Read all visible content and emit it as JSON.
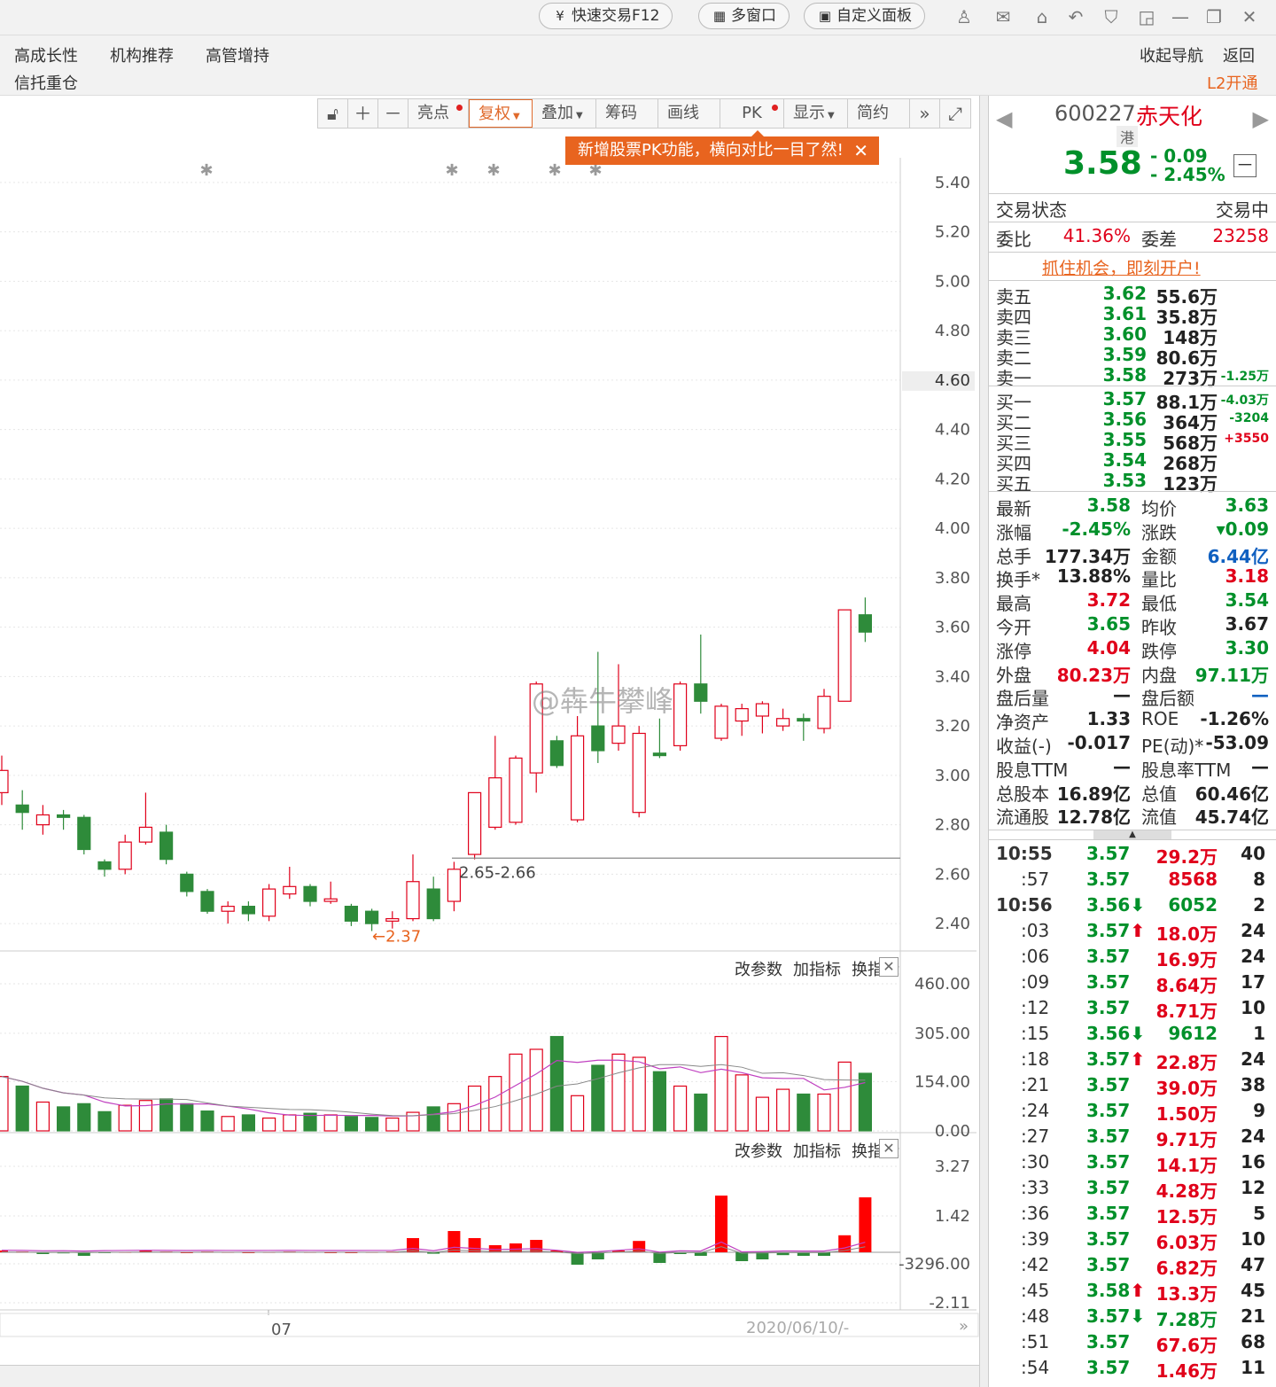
{
  "titlebar": {
    "quick_trade": "快速交易F12",
    "multi_window": "多窗口",
    "custom_panel": "自定义面板"
  },
  "nav": {
    "items": [
      "高成长性",
      "机构推荐",
      "高管增持",
      "信托重仓"
    ],
    "collapse": "收起导航",
    "back": "返回",
    "l2": "L2开通"
  },
  "toolbar": {
    "highlight": "亮点",
    "restore_rights": "复权",
    "overlay": "叠加",
    "chips": "筹码",
    "draw": "画线",
    "pk": "PK",
    "display": "显示",
    "simple": "简约"
  },
  "tooltip": "新增股票PK功能，横向对比一目了然!",
  "pane": {
    "change_params": "改参数",
    "add_indicator": "加指标",
    "switch_indicator": "换指标"
  },
  "watermark": "@犇牛攀峰",
  "chart_data": {
    "type": "candlestick",
    "price_axis": [
      "5.40",
      "5.20",
      "5.00",
      "4.80",
      "4.60",
      "4.40",
      "4.20",
      "4.00",
      "3.80",
      "3.60",
      "3.40",
      "3.20",
      "3.00",
      "2.80",
      "2.60",
      "2.40"
    ],
    "price_range": [
      2.3,
      5.5
    ],
    "current_price_label": "4.60",
    "candles": [
      {
        "o": 2.93,
        "c": 3.02,
        "h": 3.08,
        "l": 2.88
      },
      {
        "o": 2.88,
        "c": 2.85,
        "h": 2.94,
        "l": 2.78
      },
      {
        "o": 2.8,
        "c": 2.84,
        "h": 2.88,
        "l": 2.76
      },
      {
        "o": 2.84,
        "c": 2.83,
        "h": 2.86,
        "l": 2.78
      },
      {
        "o": 2.83,
        "c": 2.7,
        "h": 2.84,
        "l": 2.68
      },
      {
        "o": 2.65,
        "c": 2.62,
        "h": 2.66,
        "l": 2.59
      },
      {
        "o": 2.62,
        "c": 2.73,
        "h": 2.76,
        "l": 2.6
      },
      {
        "o": 2.73,
        "c": 2.79,
        "h": 2.93,
        "l": 2.72
      },
      {
        "o": 2.77,
        "c": 2.66,
        "h": 2.8,
        "l": 2.64
      },
      {
        "o": 2.6,
        "c": 2.53,
        "h": 2.61,
        "l": 2.51
      },
      {
        "o": 2.53,
        "c": 2.45,
        "h": 2.54,
        "l": 2.44
      },
      {
        "o": 2.45,
        "c": 2.47,
        "h": 2.49,
        "l": 2.4
      },
      {
        "o": 2.47,
        "c": 2.44,
        "h": 2.49,
        "l": 2.41
      },
      {
        "o": 2.43,
        "c": 2.54,
        "h": 2.56,
        "l": 2.41
      },
      {
        "o": 2.52,
        "c": 2.55,
        "h": 2.63,
        "l": 2.5
      },
      {
        "o": 2.55,
        "c": 2.49,
        "h": 2.56,
        "l": 2.47
      },
      {
        "o": 2.49,
        "c": 2.5,
        "h": 2.57,
        "l": 2.48
      },
      {
        "o": 2.47,
        "c": 2.41,
        "h": 2.48,
        "l": 2.39
      },
      {
        "o": 2.45,
        "c": 2.4,
        "h": 2.46,
        "l": 2.37
      },
      {
        "o": 2.41,
        "c": 2.42,
        "h": 2.45,
        "l": 2.38
      },
      {
        "o": 2.42,
        "c": 2.57,
        "h": 2.68,
        "l": 2.41
      },
      {
        "o": 2.54,
        "c": 2.42,
        "h": 2.59,
        "l": 2.41
      },
      {
        "o": 2.49,
        "c": 2.62,
        "h": 2.65,
        "l": 2.45
      },
      {
        "o": 2.68,
        "c": 2.93,
        "h": 2.93,
        "l": 2.66
      },
      {
        "o": 2.79,
        "c": 2.99,
        "h": 3.16,
        "l": 2.78
      },
      {
        "o": 2.81,
        "c": 3.07,
        "h": 3.08,
        "l": 2.8
      },
      {
        "o": 3.01,
        "c": 3.37,
        "h": 3.38,
        "l": 2.93
      },
      {
        "o": 3.14,
        "c": 3.04,
        "h": 3.16,
        "l": 3.03
      },
      {
        "o": 2.82,
        "c": 3.16,
        "h": 3.24,
        "l": 2.81
      },
      {
        "o": 3.2,
        "c": 3.1,
        "h": 3.5,
        "l": 3.05
      },
      {
        "o": 3.13,
        "c": 3.2,
        "h": 3.45,
        "l": 3.1
      },
      {
        "o": 2.85,
        "c": 3.17,
        "h": 3.2,
        "l": 2.83
      },
      {
        "o": 3.09,
        "c": 3.08,
        "h": 3.23,
        "l": 3.07
      },
      {
        "o": 3.12,
        "c": 3.37,
        "h": 3.38,
        "l": 3.1
      },
      {
        "o": 3.37,
        "c": 3.3,
        "h": 3.57,
        "l": 3.25
      },
      {
        "o": 3.15,
        "c": 3.28,
        "h": 3.29,
        "l": 3.14
      },
      {
        "o": 3.22,
        "c": 3.27,
        "h": 3.29,
        "l": 3.16
      },
      {
        "o": 3.24,
        "c": 3.29,
        "h": 3.3,
        "l": 3.17
      },
      {
        "o": 3.2,
        "c": 3.23,
        "h": 3.27,
        "l": 3.18
      },
      {
        "o": 3.23,
        "c": 3.22,
        "h": 3.25,
        "l": 3.14
      },
      {
        "o": 3.19,
        "c": 3.32,
        "h": 3.35,
        "l": 3.17
      },
      {
        "o": 3.3,
        "c": 3.67,
        "h": 3.67,
        "l": 3.3
      },
      {
        "o": 3.65,
        "c": 3.58,
        "h": 3.72,
        "l": 3.54
      }
    ],
    "annotations": {
      "low_label": "←2.37",
      "range_label": "2.65-2.66"
    },
    "volume_axis": [
      "460.00",
      "305.00",
      "154.00",
      "0.00"
    ],
    "volume_max": 460,
    "volumes": [
      170,
      140,
      90,
      75,
      85,
      60,
      80,
      95,
      100,
      85,
      62,
      45,
      50,
      40,
      50,
      55,
      50,
      45,
      42,
      40,
      58,
      75,
      85,
      140,
      170,
      240,
      255,
      295,
      110,
      205,
      240,
      230,
      185,
      140,
      115,
      295,
      175,
      105,
      130,
      115,
      115,
      215,
      180
    ],
    "macd_axis": [
      "3.27",
      "1.42",
      "-3296.00",
      "-2.11"
    ],
    "macd": [
      0.05,
      0.02,
      -0.05,
      -0.03,
      -0.1,
      -0.02,
      0.01,
      0.05,
      0.02,
      0.0,
      0.02,
      0.01,
      0.0,
      0.01,
      0.02,
      0.01,
      0.0,
      0.0,
      0.01,
      0.02,
      0.4,
      -0.04,
      0.6,
      0.4,
      0.2,
      0.25,
      0.35,
      0.05,
      -0.35,
      -0.2,
      0.05,
      0.32,
      -0.3,
      -0.05,
      -0.1,
      1.6,
      -0.25,
      -0.2,
      -0.08,
      -0.1,
      -0.1,
      0.48,
      1.55
    ],
    "x_label": "07",
    "bottom_date": "2020/06/10/-"
  },
  "quote": {
    "code": "600227",
    "name": "赤天化",
    "hk_tag": "港",
    "price": "3.58",
    "change": "- 0.09",
    "pct": "- 2.45%",
    "status_label": "交易状态",
    "status_value": "交易中",
    "weibi_label": "委比",
    "weibi_value": "41.36%",
    "weicha_label": "委差",
    "weicha_value": "23258",
    "ad": "抓住机会，即刻开户!",
    "sells": [
      {
        "label": "卖五",
        "price": "3.62",
        "vol": "55.6万",
        "delta": ""
      },
      {
        "label": "卖四",
        "price": "3.61",
        "vol": "35.8万",
        "delta": ""
      },
      {
        "label": "卖三",
        "price": "3.60",
        "vol": "148万",
        "delta": ""
      },
      {
        "label": "卖二",
        "price": "3.59",
        "vol": "80.6万",
        "delta": ""
      },
      {
        "label": "卖一",
        "price": "3.58",
        "vol": "273万",
        "delta": "-1.25万"
      }
    ],
    "buys": [
      {
        "label": "买一",
        "price": "3.57",
        "vol": "88.1万",
        "delta": "-4.03万"
      },
      {
        "label": "买二",
        "price": "3.56",
        "vol": "364万",
        "delta": "-3204"
      },
      {
        "label": "买三",
        "price": "3.55",
        "vol": "568万",
        "delta": "+3550"
      },
      {
        "label": "买四",
        "price": "3.54",
        "vol": "268万",
        "delta": ""
      },
      {
        "label": "买五",
        "price": "3.53",
        "vol": "123万",
        "delta": ""
      }
    ],
    "stats": [
      [
        "最新",
        "3.58",
        "green",
        "均价",
        "3.63",
        "green"
      ],
      [
        "涨幅",
        "-2.45%",
        "green",
        "涨跌",
        "▾0.09",
        "green"
      ],
      [
        "总手",
        "177.34万",
        "dark",
        "金额",
        "6.44亿",
        "blue"
      ],
      [
        "换手*",
        "13.88%",
        "dark",
        "量比",
        "3.18",
        "red"
      ],
      [
        "最高",
        "3.72",
        "red",
        "最低",
        "3.54",
        "green"
      ],
      [
        "今开",
        "3.65",
        "green",
        "昨收",
        "3.67",
        "dark"
      ],
      [
        "涨停",
        "4.04",
        "red",
        "跌停",
        "3.30",
        "green"
      ],
      [
        "外盘",
        "80.23万",
        "red",
        "内盘",
        "97.11万",
        "green"
      ],
      [
        "盘后量",
        "—",
        "dark",
        "盘后额",
        "—",
        "blue"
      ],
      [
        "净资产",
        "1.33",
        "dark",
        "ROE",
        "-1.26%",
        "dark"
      ],
      [
        "收益(-)",
        "-0.017",
        "dark",
        "PE(动)*",
        "-53.09",
        "dark"
      ],
      [
        "股息TTM",
        "—",
        "dark",
        "股息率TTM",
        "—",
        "dark"
      ],
      [
        "总股本",
        "16.89亿",
        "dark",
        "总值",
        "60.46亿",
        "dark"
      ],
      [
        "流通股",
        "12.78亿",
        "dark",
        "流值",
        "45.74亿",
        "dark"
      ]
    ],
    "ticks": [
      {
        "time": "10:55",
        "price": "3.57",
        "arrow": "",
        "vol": "29.2万",
        "vcolor": "red",
        "n": "40"
      },
      {
        "time": ":57",
        "price": "3.57",
        "arrow": "",
        "vol": "8568",
        "vcolor": "red",
        "n": "8"
      },
      {
        "time": "10:56",
        "price": "3.56",
        "arrow": "down",
        "vol": "6052",
        "vcolor": "green",
        "n": "2"
      },
      {
        "time": ":03",
        "price": "3.57",
        "arrow": "up",
        "vol": "18.0万",
        "vcolor": "red",
        "n": "24"
      },
      {
        "time": ":06",
        "price": "3.57",
        "arrow": "",
        "vol": "16.9万",
        "vcolor": "red",
        "n": "24"
      },
      {
        "time": ":09",
        "price": "3.57",
        "arrow": "",
        "vol": "8.64万",
        "vcolor": "red",
        "n": "17"
      },
      {
        "time": ":12",
        "price": "3.57",
        "arrow": "",
        "vol": "8.71万",
        "vcolor": "red",
        "n": "10"
      },
      {
        "time": ":15",
        "price": "3.56",
        "arrow": "down",
        "vol": "9612",
        "vcolor": "green",
        "n": "1"
      },
      {
        "time": ":18",
        "price": "3.57",
        "arrow": "up",
        "vol": "22.8万",
        "vcolor": "red",
        "n": "24"
      },
      {
        "time": ":21",
        "price": "3.57",
        "arrow": "",
        "vol": "39.0万",
        "vcolor": "red",
        "n": "38"
      },
      {
        "time": ":24",
        "price": "3.57",
        "arrow": "",
        "vol": "1.50万",
        "vcolor": "red",
        "n": "9"
      },
      {
        "time": ":27",
        "price": "3.57",
        "arrow": "",
        "vol": "9.71万",
        "vcolor": "red",
        "n": "24"
      },
      {
        "time": ":30",
        "price": "3.57",
        "arrow": "",
        "vol": "14.1万",
        "vcolor": "red",
        "n": "16"
      },
      {
        "time": ":33",
        "price": "3.57",
        "arrow": "",
        "vol": "4.28万",
        "vcolor": "red",
        "n": "12"
      },
      {
        "time": ":36",
        "price": "3.57",
        "arrow": "",
        "vol": "12.5万",
        "vcolor": "red",
        "n": "5"
      },
      {
        "time": ":39",
        "price": "3.57",
        "arrow": "",
        "vol": "6.03万",
        "vcolor": "red",
        "n": "10"
      },
      {
        "time": ":42",
        "price": "3.57",
        "arrow": "",
        "vol": "6.82万",
        "vcolor": "red",
        "n": "47"
      },
      {
        "time": ":45",
        "price": "3.58",
        "arrow": "up",
        "vol": "13.3万",
        "vcolor": "red",
        "n": "45"
      },
      {
        "time": ":48",
        "price": "3.57",
        "arrow": "down",
        "vol": "7.28万",
        "vcolor": "green",
        "n": "21"
      },
      {
        "time": ":51",
        "price": "3.57",
        "arrow": "",
        "vol": "67.6万",
        "vcolor": "red",
        "n": "68"
      },
      {
        "time": ":54",
        "price": "3.57",
        "arrow": "",
        "vol": "1.46万",
        "vcolor": "red",
        "n": "11"
      }
    ]
  },
  "colors": {
    "up": "#e0001a",
    "down": "#2e8b3a",
    "accent": "#e8641f"
  }
}
